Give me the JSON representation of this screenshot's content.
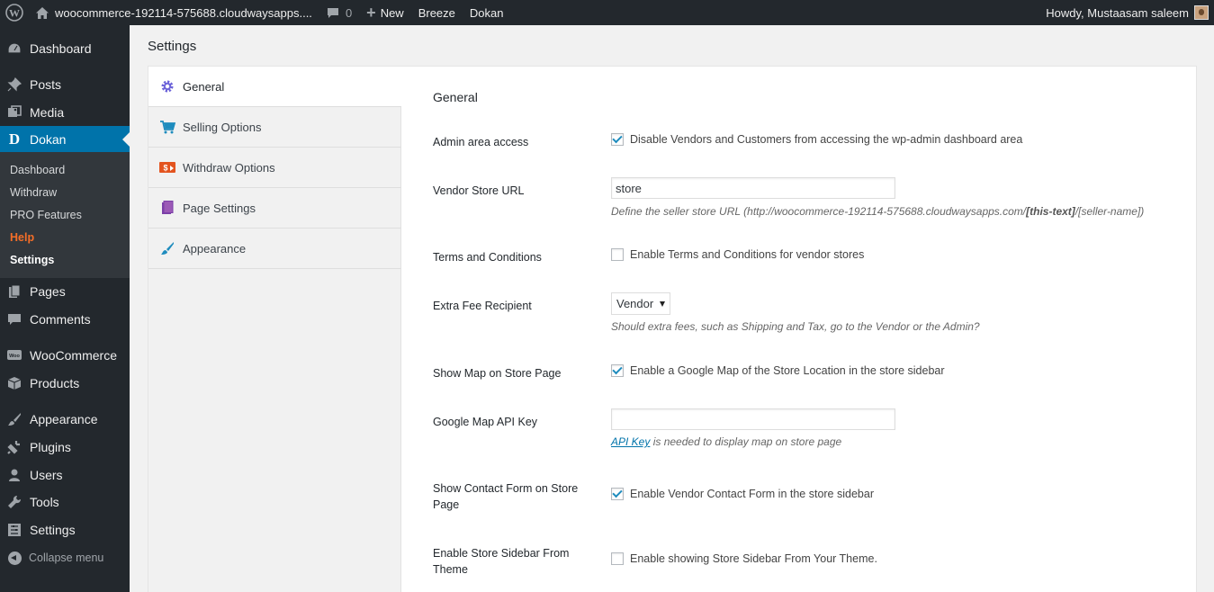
{
  "adminbar": {
    "site_name": "woocommerce-192114-575688.cloudwaysapps....",
    "comments_count": "0",
    "new_label": "New",
    "breeze_label": "Breeze",
    "dokan_label": "Dokan",
    "howdy": "Howdy, Mustaasam saleem"
  },
  "menu": {
    "dashboard": "Dashboard",
    "posts": "Posts",
    "media": "Media",
    "dokan": "Dokan",
    "sub": {
      "dashboard": "Dashboard",
      "withdraw": "Withdraw",
      "pro": "PRO Features",
      "help": "Help",
      "settings": "Settings"
    },
    "pages": "Pages",
    "comments": "Comments",
    "woocommerce": "WooCommerce",
    "products": "Products",
    "appearance": "Appearance",
    "plugins": "Plugins",
    "users": "Users",
    "tools": "Tools",
    "settings": "Settings",
    "collapse": "Collapse menu"
  },
  "page": {
    "title": "Settings"
  },
  "tabs": {
    "general": "General",
    "selling": "Selling Options",
    "withdraw": "Withdraw Options",
    "page_settings": "Page Settings",
    "appearance": "Appearance"
  },
  "general": {
    "title": "General",
    "admin_access": {
      "label": "Admin area access",
      "text": "Disable Vendors and Customers from accessing the wp-admin dashboard area",
      "checked": true
    },
    "store_url": {
      "label": "Vendor Store URL",
      "value": "store",
      "desc_prefix": "Define the seller store URL (http://woocommerce-192114-575688.cloudwaysapps.com/",
      "desc_bold": "[this-text]",
      "desc_suffix": "/[seller-name])"
    },
    "terms": {
      "label": "Terms and Conditions",
      "text": "Enable Terms and Conditions for vendor stores",
      "checked": false
    },
    "extra_fee": {
      "label": "Extra Fee Recipient",
      "selected": "Vendor",
      "desc": "Should extra fees, such as Shipping and Tax, go to the Vendor or the Admin?"
    },
    "show_map": {
      "label": "Show Map on Store Page",
      "text": "Enable a Google Map of the Store Location in the store sidebar",
      "checked": true
    },
    "map_api": {
      "label": "Google Map API Key",
      "value": "",
      "desc_link": "API Key",
      "desc_rest": " is needed to display map on store page"
    },
    "contact_form": {
      "label": "Show Contact Form on Store Page",
      "text": "Enable Vendor Contact Form in the store sidebar",
      "checked": true
    },
    "store_sidebar": {
      "label": "Enable Store Sidebar From Theme",
      "text": "Enable showing Store Sidebar From Your Theme.",
      "checked": false
    }
  },
  "colors": {
    "adminbar": "#23282d",
    "accent": "#0073aa",
    "help": "#f56e28"
  }
}
